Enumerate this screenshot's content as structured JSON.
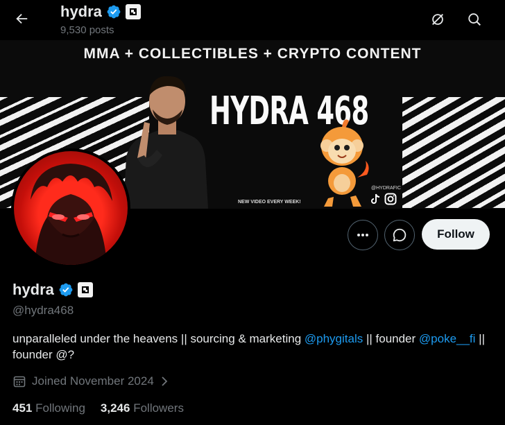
{
  "header": {
    "name": "hydra",
    "posts": "9,530 posts"
  },
  "banner": {
    "tagline": "MMA + COLLECTIBLES + CRYPTO CONTENT",
    "title": "HYDRA 468",
    "subline": "NEW VIDEO EVERY WEEK!",
    "social_handle": "@HYDRAFIC"
  },
  "actions": {
    "follow_label": "Follow"
  },
  "profile": {
    "name": "hydra",
    "handle": "@hydra468",
    "bio": {
      "part1": "unparalleled under the heavens || sourcing & marketing ",
      "link1": "@phygitals",
      "part2": " || founder ",
      "link2": "@poke__fi",
      "part3": " || founder @?"
    },
    "joined": "Joined November 2024",
    "following_count": "451",
    "following_label": "Following",
    "followers_count": "3,246",
    "followers_label": "Followers"
  },
  "colors": {
    "accent": "#1d9bf0",
    "verified": "#1d9bf0",
    "follow_bg": "#eff3f4",
    "muted": "#71767b"
  },
  "icons": [
    "back-arrow-icon",
    "verified-badge-icon",
    "affiliate-badge-icon",
    "grok-icon",
    "search-icon",
    "more-icon",
    "message-icon",
    "calendar-icon",
    "chevron-right-icon",
    "tiktok-icon",
    "instagram-icon"
  ]
}
